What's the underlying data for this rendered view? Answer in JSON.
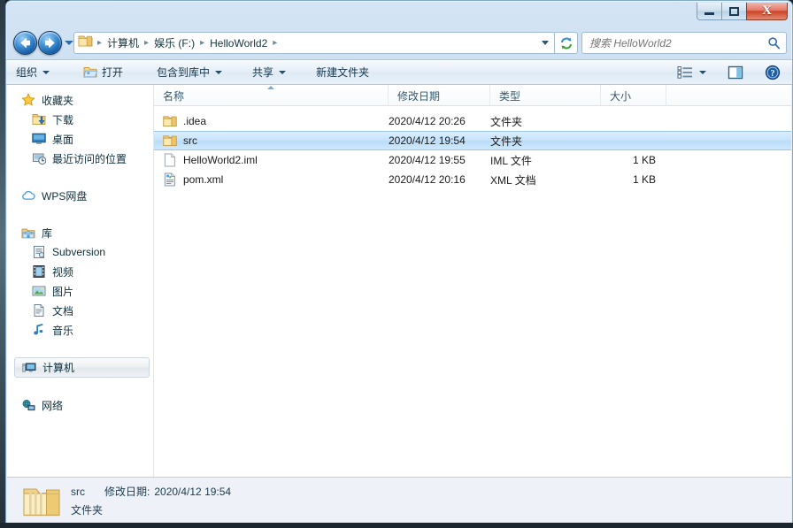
{
  "window": {
    "controls": {
      "minimize": "–",
      "maximize": "□",
      "close": "X"
    }
  },
  "address_bar": {
    "back_tooltip": "后退",
    "forward_tooltip": "前进",
    "breadcrumbs": [
      "计算机",
      "娱乐 (F:)",
      "HelloWorld2"
    ],
    "separator": "▸",
    "refresh_tooltip": "刷新"
  },
  "search": {
    "placeholder": "搜索 HelloWorld2",
    "value": ""
  },
  "toolbar": {
    "items": [
      {
        "label": "组织",
        "has_caret": true,
        "icon": null
      },
      {
        "label": "打开",
        "has_caret": false,
        "icon": "open-folder-icon"
      },
      {
        "label": "包含到库中",
        "has_caret": true,
        "icon": null
      },
      {
        "label": "共享",
        "has_caret": true,
        "icon": null
      },
      {
        "label": "新建文件夹",
        "has_caret": false,
        "icon": null
      }
    ],
    "view_button": "view-layout-icon",
    "view_caret": "▾",
    "preview_button": "preview-pane-icon",
    "help_button": "help-icon"
  },
  "sidebar": {
    "groups": [
      {
        "header": {
          "label": "收藏夹",
          "icon": "star-icon"
        },
        "items": [
          {
            "label": "下载",
            "icon": "download-icon"
          },
          {
            "label": "桌面",
            "icon": "desktop-icon"
          },
          {
            "label": "最近访问的位置",
            "icon": "recent-places-icon"
          }
        ]
      },
      {
        "header": {
          "label": "WPS网盘",
          "icon": "cloud-icon"
        },
        "items": []
      },
      {
        "header": {
          "label": "库",
          "icon": "library-icon"
        },
        "items": [
          {
            "label": "Subversion",
            "icon": "subversion-icon"
          },
          {
            "label": "视频",
            "icon": "video-icon"
          },
          {
            "label": "图片",
            "icon": "pictures-icon"
          },
          {
            "label": "文档",
            "icon": "documents-icon"
          },
          {
            "label": "音乐",
            "icon": "music-icon"
          }
        ]
      },
      {
        "header": {
          "label": "计算机",
          "icon": "computer-icon",
          "selected": true
        },
        "items": []
      },
      {
        "header": {
          "label": "网络",
          "icon": "network-icon"
        },
        "items": []
      }
    ]
  },
  "file_list": {
    "columns": [
      {
        "label": "名称",
        "sorted": true
      },
      {
        "label": "修改日期",
        "sorted": false
      },
      {
        "label": "类型",
        "sorted": false
      },
      {
        "label": "大小",
        "sorted": false
      }
    ],
    "rows": [
      {
        "name": ".idea",
        "date": "2020/4/12 20:26",
        "type": "文件夹",
        "size": "",
        "icon": "folder-icon",
        "selected": false
      },
      {
        "name": "src",
        "date": "2020/4/12 19:54",
        "type": "文件夹",
        "size": "",
        "icon": "folder-icon",
        "selected": true
      },
      {
        "name": "HelloWorld2.iml",
        "date": "2020/4/12 19:55",
        "type": "IML 文件",
        "size": "1 KB",
        "icon": "blank-file-icon",
        "selected": false
      },
      {
        "name": "pom.xml",
        "date": "2020/4/12 20:16",
        "type": "XML 文档",
        "size": "1 KB",
        "icon": "xml-file-icon",
        "selected": false
      }
    ]
  },
  "status_bar": {
    "icon": "large-folder-icon",
    "name": "src",
    "date_label": "修改日期:",
    "date_value": "2020/4/12 19:54",
    "type": "文件夹"
  },
  "colors": {
    "frame": "#c5dcf0",
    "selection": "#c6e3fb",
    "selection_border": "#9cc7e8",
    "toolbar_bg": "#e5eef7",
    "status_bg": "#eef1f8",
    "close_button": "#cd4326",
    "header_text": "#34586e"
  }
}
